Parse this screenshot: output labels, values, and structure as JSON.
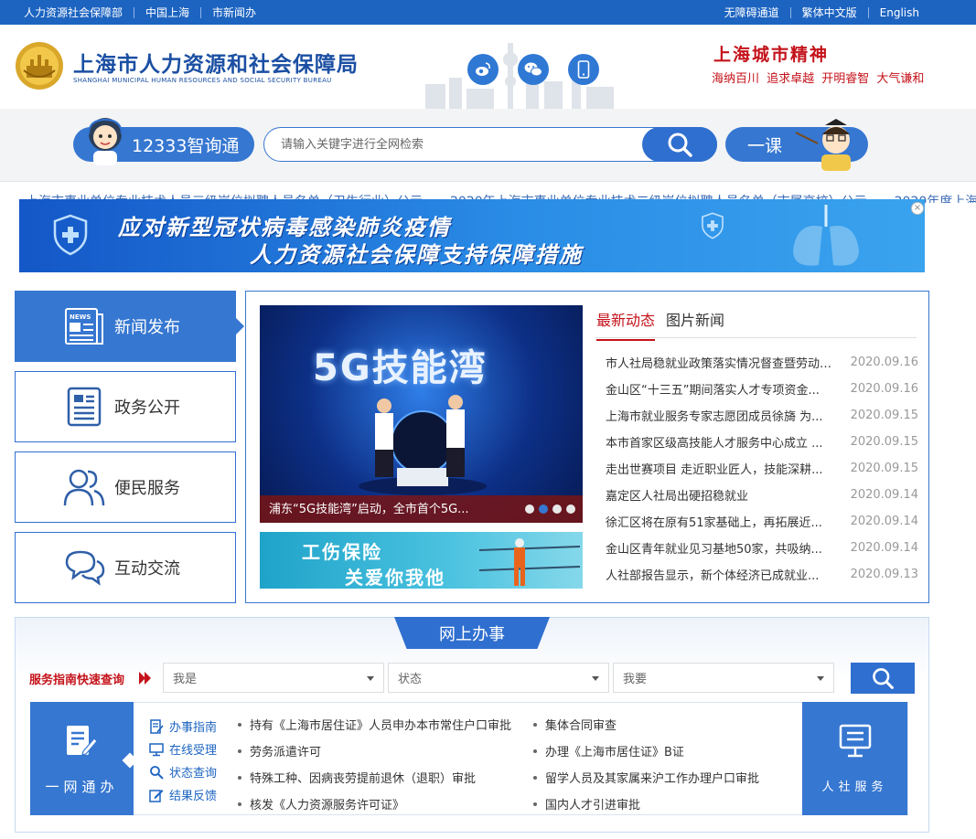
{
  "topbar": {
    "links_left": [
      "人力资源社会保障部",
      "中国上海",
      "市新闻办"
    ],
    "links_right": [
      "无障碍通道",
      "繁体中文版",
      "English"
    ]
  },
  "header": {
    "title": "上海市人力资源和社会保障局",
    "subtitle": "SHANGHAI MUNICIPAL HUMAN RESOURCES AND SOCIAL SECURITY BUREAU",
    "social_icons": [
      "weibo-icon",
      "wechat-icon",
      "mobile-icon"
    ],
    "slogan_title": "上海城市精神",
    "slogan_line": "海纳百川 追求卓越 开明睿智 大气谦和"
  },
  "search": {
    "hotline_label": "12333智询通",
    "placeholder": "请输入关键字进行全网检索",
    "course_label": "一课"
  },
  "marquee": {
    "items": [
      "上海市事业单位专业技术人员三级岗位拟聘人员名单（卫生行业）公示",
      "2020年上海市事业单位专业技术二级岗位拟聘人员名单（市属高校）公示",
      "2020年度上海"
    ]
  },
  "banner": {
    "line1": "应对新型冠状病毒感染肺炎疫情",
    "line2": "人力资源社会保障支持保障措施",
    "close": "×"
  },
  "left_nav": [
    {
      "label": "新闻发布",
      "icon": "newspaper-icon"
    },
    {
      "label": "政务公开",
      "icon": "document-icon"
    },
    {
      "label": "便民服务",
      "icon": "people-icon"
    },
    {
      "label": "互动交流",
      "icon": "chat-bubbles-icon"
    }
  ],
  "news": {
    "photo_title": "5G技能湾",
    "photo_caption": "浦东“5G技能湾”启动，全市首个5G...",
    "promo_line1": "工伤保险",
    "promo_line2": "关爱你我他",
    "tabs": [
      "最新动态",
      "图片新闻"
    ],
    "items": [
      {
        "title": "市人社局稳就业政策落实情况督查暨劳动关系...",
        "date": "2020.09.16"
      },
      {
        "title": "金山区“十三五”期间落实人才专项资金...",
        "date": "2020.09.16"
      },
      {
        "title": "上海市就业服务专家志愿团成员徐旖 为...",
        "date": "2020.09.15"
      },
      {
        "title": "本市首家区级高技能人才服务中心成立 ...",
        "date": "2020.09.15"
      },
      {
        "title": "走出世赛项目 走近职业匠人，技能深耕...",
        "date": "2020.09.15"
      },
      {
        "title": "嘉定区人社局出硬招稳就业",
        "date": "2020.09.14"
      },
      {
        "title": "徐汇区将在原有51家基础上，再拓展近...",
        "date": "2020.09.14"
      },
      {
        "title": "金山区青年就业见习基地50家，共吸纳...",
        "date": "2020.09.14"
      },
      {
        "title": "人社部报告显示，新个体经济已成就业...",
        "date": "2020.09.13"
      }
    ]
  },
  "services": {
    "title": "网上办事",
    "quick_label": "服务指南快速查询",
    "selects": [
      "我是",
      "状态",
      "我要"
    ],
    "yiwang_label": "一网通办",
    "guides": [
      {
        "label": "办事指南",
        "icon": "guide-icon"
      },
      {
        "label": "在线受理",
        "icon": "monitor-icon"
      },
      {
        "label": "状态查询",
        "icon": "magnifier-icon"
      },
      {
        "label": "结果反馈",
        "icon": "edit-icon"
      }
    ],
    "items_col1": [
      "持有《上海市居住证》人员申办本市常住户口审批",
      "劳务派遣许可",
      "特殊工种、因病丧劳提前退休（退职）审批",
      "核发《人力资源服务许可证》"
    ],
    "items_col2": [
      "集体合同审查",
      "办理《上海市居住证》B证",
      "留学人员及其家属来沪工作办理户口审批",
      "国内人才引进审批"
    ],
    "renshe_label": "人社服务"
  }
}
